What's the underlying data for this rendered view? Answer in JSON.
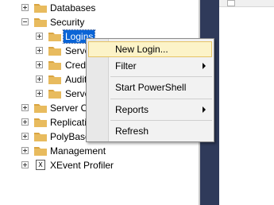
{
  "tree": {
    "items": [
      {
        "label": "Databases"
      },
      {
        "label": "Security"
      },
      {
        "label": "Logins"
      },
      {
        "label": "Serve"
      },
      {
        "label": "Credo"
      },
      {
        "label": "Audit"
      },
      {
        "label": "Serve"
      },
      {
        "label": "Server O"
      },
      {
        "label": "Replicati"
      },
      {
        "label": "PolyBase"
      },
      {
        "label": "Management"
      },
      {
        "label": "XEvent Profiler"
      }
    ]
  },
  "context_menu": {
    "items": [
      {
        "label": "New Login..."
      },
      {
        "label": "Filter"
      },
      {
        "label": "Start PowerShell"
      },
      {
        "label": "Reports"
      },
      {
        "label": "Refresh"
      }
    ]
  },
  "colors": {
    "folder": "#d9a441",
    "selection": "#0a64d6",
    "menu_highlight": "#fcf3c8",
    "right_bg": "#2f3a5a"
  },
  "icons": {
    "xevent": "X"
  }
}
